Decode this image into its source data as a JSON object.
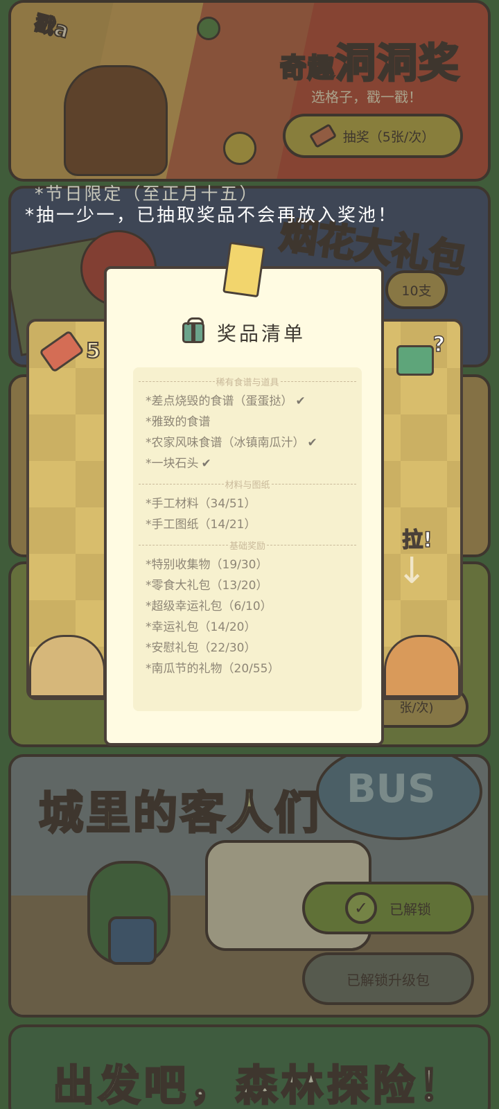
{
  "lottery": {
    "title_small": "奇趣",
    "title_big": "洞洞奖",
    "subtitle": "选格子，戳一戳！",
    "poke_text": "戳a",
    "draw_button": "抽奖（5张/次）"
  },
  "fireworks": {
    "title": "烟花大礼包",
    "notice_1": "*节日限定（至正月十五）",
    "notice_2": "*抽一少一，已抽取奖品不会再放入奖池！",
    "partial_button": "10支"
  },
  "grid_panel": {
    "ticket_count": "5",
    "pull_label": "拉!",
    "gift_mark": "?",
    "bottom_fragment": "张/次)"
  },
  "modal": {
    "title": "奖品清单",
    "sections": [
      {
        "heading": "稀有食谱与道具",
        "items": [
          {
            "label": "*差点烧毁的食谱（蛋蛋挞）",
            "checked": true
          },
          {
            "label": "*雅致的食谱",
            "checked": false
          },
          {
            "label": "*农家风味食谱（冰镇南瓜汁）",
            "checked": true
          },
          {
            "label": "*一块石头",
            "checked": true
          }
        ]
      },
      {
        "heading": "材料与图纸",
        "items": [
          {
            "label": "*手工材料（34/51）",
            "checked": false
          },
          {
            "label": "*手工图纸（14/21）",
            "checked": false
          }
        ]
      },
      {
        "heading": "基础奖励",
        "items": [
          {
            "label": "*特别收集物（19/30）",
            "checked": false
          },
          {
            "label": "*零食大礼包（13/20）",
            "checked": false
          },
          {
            "label": "*超级幸运礼包（6/10）",
            "checked": false
          },
          {
            "label": "*幸运礼包（14/20）",
            "checked": false
          },
          {
            "label": "*安慰礼包（22/30）",
            "checked": false
          },
          {
            "label": "*南瓜节的礼物（20/55）",
            "checked": false
          }
        ]
      }
    ]
  },
  "guests": {
    "title": "城里的客人们",
    "bus_sign": "BUS",
    "unlocked_button": "已解锁",
    "upgrade_button": "已解锁升级包"
  },
  "forest": {
    "title": "出发吧，森林探险！"
  }
}
